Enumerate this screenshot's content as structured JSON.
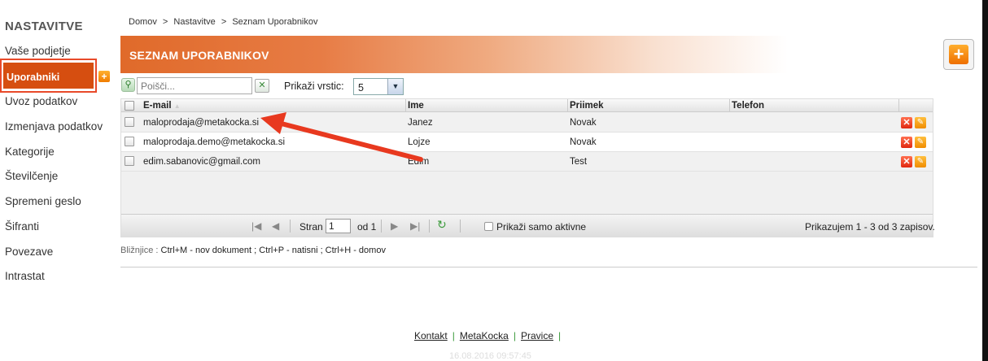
{
  "sidebar": {
    "title": "NASTAVITVE",
    "items": [
      {
        "label": "Vaše podjetje"
      },
      {
        "label": "Uporabniki"
      },
      {
        "label": "Uvoz podatkov"
      },
      {
        "label": "Izmenjava podatkov"
      },
      {
        "label": "Kategorije"
      },
      {
        "label": "Številčenje"
      },
      {
        "label": "Spremeni geslo"
      },
      {
        "label": "Šifranti"
      },
      {
        "label": "Povezave"
      },
      {
        "label": "Intrastat"
      }
    ],
    "add_glyph": "+"
  },
  "breadcrumb": {
    "items": [
      "Domov",
      "Nastavitve",
      "Seznam Uporabnikov"
    ],
    "separator": ">"
  },
  "header": {
    "title": "SEZNAM UPORABNIKOV",
    "add_glyph": "+"
  },
  "toolbar": {
    "search_placeholder": "Poišči...",
    "rows_label": "Prikaži vrstic:",
    "rows_value": "5"
  },
  "grid": {
    "columns": [
      "E-mail",
      "Ime",
      "Priimek",
      "Telefon"
    ],
    "rows": [
      {
        "email": "maloprodaja@metakocka.si",
        "ime": "Janez",
        "priimek": "Novak",
        "telefon": ""
      },
      {
        "email": "maloprodaja.demo@metakocka.si",
        "ime": "Lojze",
        "priimek": "Novak",
        "telefon": ""
      },
      {
        "email": "edim.sabanovic@gmail.com",
        "ime": "Edim",
        "priimek": "Test",
        "telefon": ""
      }
    ],
    "pager": {
      "page_label": "Stran",
      "page_value": "1",
      "of_label": "od 1",
      "active_only_label": "Prikaži samo aktivne",
      "summary": "Prikazujem 1 - 3 od 3 zapisov."
    }
  },
  "shortcuts": {
    "label": "Bližnjice :",
    "text": "Ctrl+M - nov dokument ;  Ctrl+P - natisni ;  Ctrl+H - domov"
  },
  "footer": {
    "links": [
      "Kontakt",
      "MetaKocka",
      "Pravice"
    ],
    "timestamp": "16.08.2016 09:57:45"
  },
  "colors": {
    "accent": "#d64e10",
    "annotation_arrow": "#e8391f",
    "annotation_box": "#e84a2a"
  },
  "icons": {
    "search": "search-icon",
    "clear": "clear-icon",
    "delete": "delete-icon",
    "edit": "pencil-icon",
    "refresh": "refresh-icon",
    "add": "plus-icon"
  }
}
